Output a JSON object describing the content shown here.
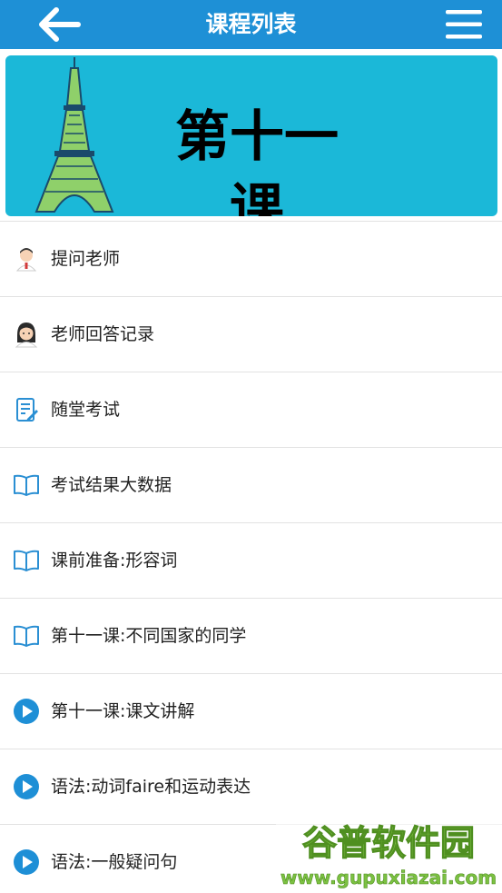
{
  "header": {
    "title": "课程列表",
    "back_icon": "arrow-left-icon",
    "menu_icon": "hamburger-menu-icon",
    "bar_color": "#1e90d6"
  },
  "banner": {
    "text": "第十一课",
    "background": "#1bb8d8",
    "image": "eiffel-tower-illustration"
  },
  "items": [
    {
      "label": "提问老师",
      "icon": "teacher-male-avatar-icon"
    },
    {
      "label": "老师回答记录",
      "icon": "teacher-female-avatar-icon"
    },
    {
      "label": "随堂考试",
      "icon": "exam-edit-icon"
    },
    {
      "label": "考试结果大数据",
      "icon": "open-book-icon"
    },
    {
      "label": "课前准备:形容词",
      "icon": "open-book-icon"
    },
    {
      "label": "第十一课:不同国家的同学",
      "icon": "open-book-icon"
    },
    {
      "label": "第十一课:课文讲解",
      "icon": "play-circle-icon"
    },
    {
      "label": "语法:动词faire和运动表达",
      "icon": "play-circle-icon"
    },
    {
      "label": "语法:一般疑问句",
      "icon": "play-circle-icon"
    }
  ],
  "watermark": {
    "title": "谷普软件园",
    "url": "www.gupuxiazai.com"
  }
}
